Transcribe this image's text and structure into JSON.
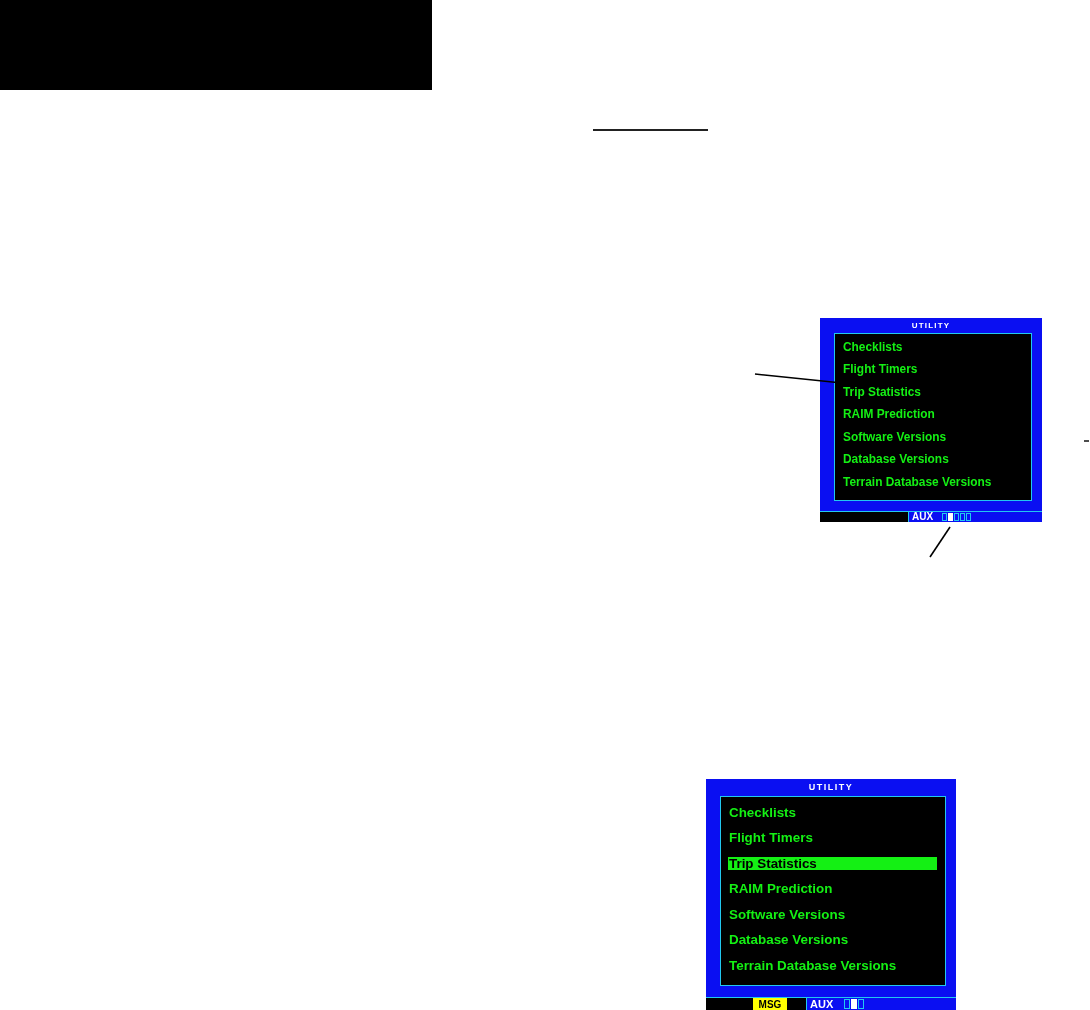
{
  "screens": [
    {
      "title": "UTILITY",
      "items": [
        {
          "label": "Checklists",
          "selected": false
        },
        {
          "label": "Flight Timers",
          "selected": false
        },
        {
          "label": "Trip Statistics",
          "selected": false
        },
        {
          "label": "RAIM Prediction",
          "selected": false
        },
        {
          "label": "Software Versions",
          "selected": false
        },
        {
          "label": "Database Versions",
          "selected": false
        },
        {
          "label": "Terrain Database Versions",
          "selected": false
        }
      ],
      "status_bar": {
        "page_group": "AUX",
        "pages": [
          {
            "selected": false
          },
          {
            "selected": true
          },
          {
            "selected": false
          },
          {
            "selected": false
          },
          {
            "selected": false
          }
        ]
      }
    },
    {
      "title": "UTILITY",
      "items": [
        {
          "label": "Checklists",
          "selected": false
        },
        {
          "label": "Flight Timers",
          "selected": false
        },
        {
          "label": "Trip Statistics",
          "selected": true
        },
        {
          "label": "RAIM Prediction",
          "selected": false
        },
        {
          "label": "Software Versions",
          "selected": false
        },
        {
          "label": "Database Versions",
          "selected": false
        },
        {
          "label": "Terrain Database Versions",
          "selected": false
        }
      ],
      "status_bar": {
        "message": "MSG",
        "page_group": "AUX",
        "pages": [
          {
            "selected": false
          },
          {
            "selected": true
          },
          {
            "selected": false
          }
        ]
      }
    }
  ]
}
